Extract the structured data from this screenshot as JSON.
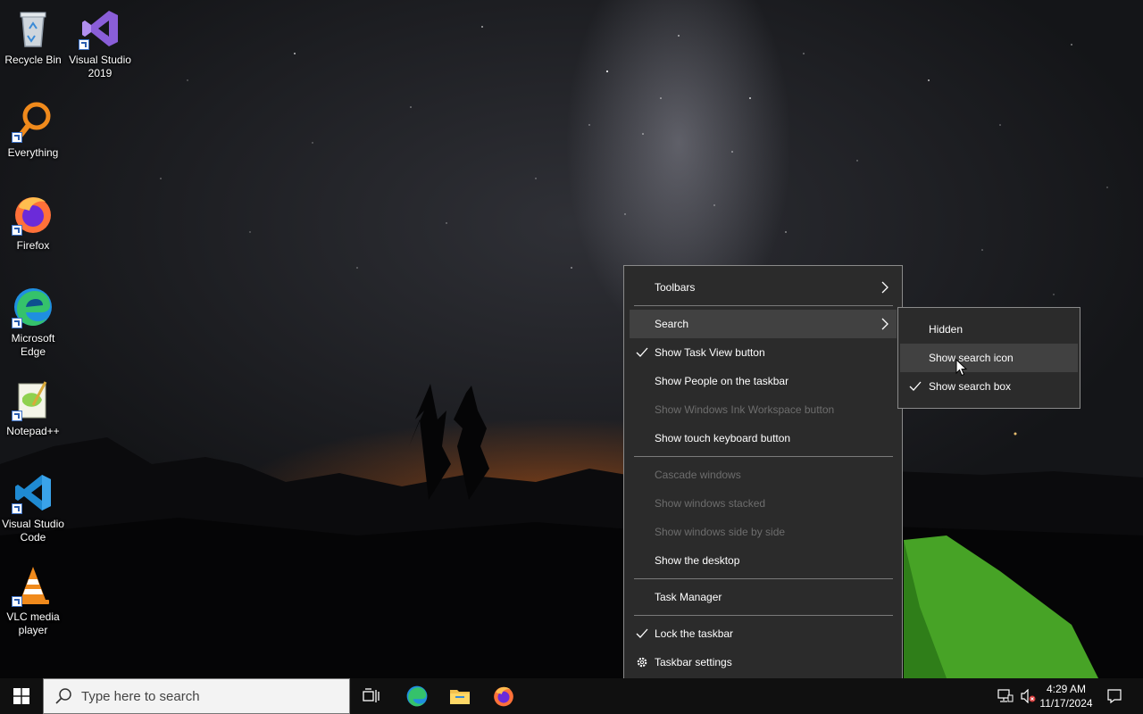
{
  "desktop": {
    "icons": [
      {
        "label": "Recycle Bin",
        "icon": "recycle-bin-icon"
      },
      {
        "label": "Visual Studio 2019",
        "icon": "visual-studio-2019-icon"
      },
      {
        "label": "Everything",
        "icon": "everything-search-icon"
      },
      {
        "label": "Firefox",
        "icon": "firefox-icon"
      },
      {
        "label": "Microsoft Edge",
        "icon": "edge-icon"
      },
      {
        "label": "Notepad++",
        "icon": "notepadpp-icon"
      },
      {
        "label": "Visual Studio Code",
        "icon": "vscode-icon"
      },
      {
        "label": "VLC media player",
        "icon": "vlc-icon"
      }
    ]
  },
  "context_menu": {
    "items": [
      {
        "label": "Toolbars",
        "has_submenu": true,
        "enabled": true,
        "checked": false
      },
      {
        "label": "Search",
        "has_submenu": true,
        "enabled": true,
        "checked": false,
        "highlighted": true
      },
      {
        "label": "Show Task View button",
        "enabled": true,
        "checked": true
      },
      {
        "label": "Show People on the taskbar",
        "enabled": true,
        "checked": false
      },
      {
        "label": "Show Windows Ink Workspace button",
        "enabled": false,
        "checked": false
      },
      {
        "label": "Show touch keyboard button",
        "enabled": true,
        "checked": false
      },
      {
        "label": "Cascade windows",
        "enabled": false,
        "checked": false
      },
      {
        "label": "Show windows stacked",
        "enabled": false,
        "checked": false
      },
      {
        "label": "Show windows side by side",
        "enabled": false,
        "checked": false
      },
      {
        "label": "Show the desktop",
        "enabled": true,
        "checked": false
      },
      {
        "label": "Task Manager",
        "enabled": true,
        "checked": false
      },
      {
        "label": "Lock the taskbar",
        "enabled": true,
        "checked": true
      },
      {
        "label": "Taskbar settings",
        "enabled": true,
        "icon": "gear-icon"
      }
    ]
  },
  "search_submenu": {
    "items": [
      {
        "label": "Hidden",
        "checked": false
      },
      {
        "label": "Show search icon",
        "checked": false,
        "hovered": true
      },
      {
        "label": "Show search box",
        "checked": true
      }
    ]
  },
  "taskbar": {
    "search_placeholder": "Type here to search",
    "pinned": [
      "task-view-icon",
      "edge-icon",
      "file-explorer-icon",
      "firefox-icon"
    ],
    "tray": [
      "network-icon",
      "volume-muted-icon",
      "notification-icon"
    ],
    "time": "4:29 AM",
    "date": "11/17/2024"
  },
  "colors": {
    "menu_bg": "#2b2b2b",
    "menu_highlight": "#414141",
    "taskbar_bg": "#101010"
  }
}
